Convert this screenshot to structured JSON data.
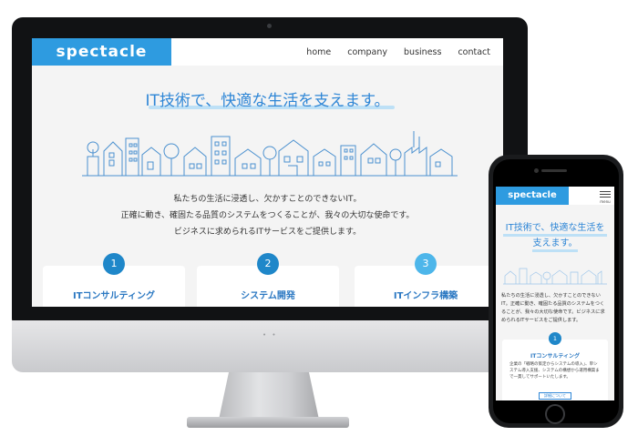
{
  "desktop": {
    "logo": "spectacle",
    "nav": [
      "home",
      "company",
      "business",
      "contact"
    ],
    "headline": "IT技術で、快適な生活を支えます。",
    "body_lines": [
      "私たちの生活に浸透し、欠かすことのできないIT。",
      "正確に動き、確固たる品質のシステムをつくることが、我々の大切な使命です。",
      "ビジネスに求められるITサービスをご提供します。"
    ],
    "cards": [
      {
        "num": "1",
        "title": "ITコンサルティング"
      },
      {
        "num": "2",
        "title": "システム開発"
      },
      {
        "num": "3",
        "title": "ITインフラ構築"
      }
    ]
  },
  "mobile": {
    "logo": "spectacle",
    "menu_label": "menu",
    "headline": "IT技術で、快適な生活を支えます。",
    "body": "私たちの生活に浸透し、欠かすことのできないIT。正確に動き、確固たる品質のシステムをつくることが、我々の大切な使命です。ビジネスに求められるITサービスをご提供します。",
    "card": {
      "num": "1",
      "title": "ITコンサルティング",
      "text": "企業の「戦略の策定からシステムの導入」、単システム導入支援、システムの構想から運用構築まで一貫してサポートいたします。",
      "button": "詳細について"
    }
  },
  "colors": {
    "brand_blue": "#2e9be0",
    "headline_blue": "#2e86d6",
    "badge_dark": "#1f87c9",
    "badge_light": "#4db6ea"
  }
}
